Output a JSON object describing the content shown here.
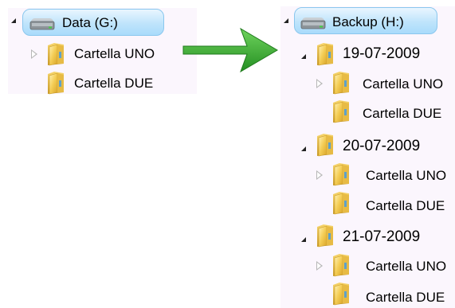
{
  "left": {
    "drive_label": "Data (G:)",
    "folders": [
      "Cartella UNO",
      "Cartella DUE"
    ]
  },
  "right": {
    "drive_label": "Backup (H:)",
    "dates": [
      {
        "label": "19-07-2009",
        "folders": [
          "Cartella UNO",
          "Cartella DUE"
        ]
      },
      {
        "label": "20-07-2009",
        "folders": [
          "Cartella UNO",
          "Cartella DUE"
        ]
      },
      {
        "label": "21-07-2009",
        "folders": [
          "Cartella UNO",
          "Cartella DUE"
        ]
      }
    ]
  },
  "colors": {
    "arrow": "#3aa633",
    "drive_highlight": "#bfe4fb",
    "folder": "#f0c851"
  },
  "icons": [
    "drive-icon",
    "folder-icon",
    "expanded-triangle-icon",
    "collapsed-triangle-icon",
    "arrow-right-icon"
  ]
}
